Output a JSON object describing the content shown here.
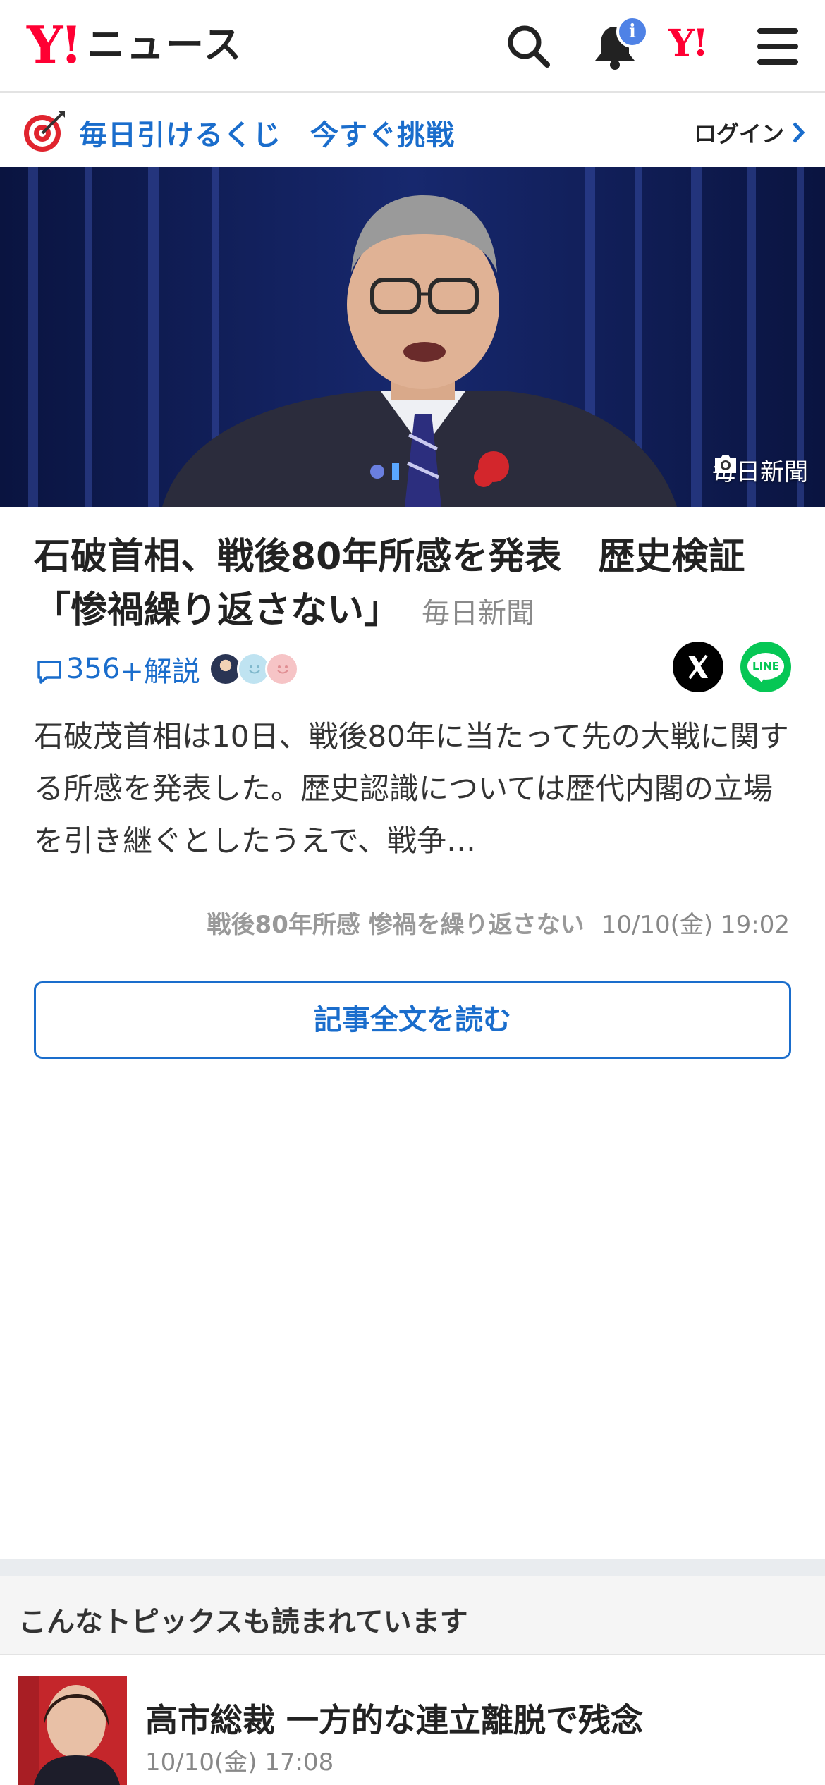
{
  "header": {
    "logo_mark": "Y!",
    "logo_text": "ニュース",
    "notification_badge": "i",
    "yahoo_mark": "Y!"
  },
  "promo": {
    "text": "毎日引けるくじ　今すぐ挑戦",
    "login_label": "ログイン"
  },
  "hero": {
    "credit": "毎日新聞"
  },
  "article": {
    "headline": "石破首相、戦後80年所感を発表　歴史検証「惨禍繰り返さない」",
    "source": "毎日新聞",
    "comment_count": "356",
    "commentary_label": "+解説",
    "share_x": "X",
    "share_line": "LINE",
    "body": "石破茂首相は10日、戦後80年に当たって先の大戦に関する所感を発表した。歴史認識については歴代内閣の立場を引き継ぐとしたうえで、戦争…",
    "topic": "戦後80年所感 惨禍を繰り返さない",
    "timestamp": "10/10(金) 19:02",
    "read_full_label": "記事全文を読む"
  },
  "related": {
    "section_title": "こんなトピックスも読まれています",
    "items": [
      {
        "title": "高市総裁 一方的な連立離脱で残念",
        "time": "10/10(金) 17:08"
      }
    ]
  },
  "colors": {
    "brand_red": "#ff0033",
    "link_blue": "#1a6dcc",
    "line_green": "#06c755",
    "badge_blue": "#4f82e6"
  },
  "icons": [
    "search-icon",
    "bell-icon",
    "menu-icon",
    "target-icon",
    "chevron-right-icon",
    "camera-icon",
    "comment-icon",
    "x-icon",
    "line-icon"
  ]
}
